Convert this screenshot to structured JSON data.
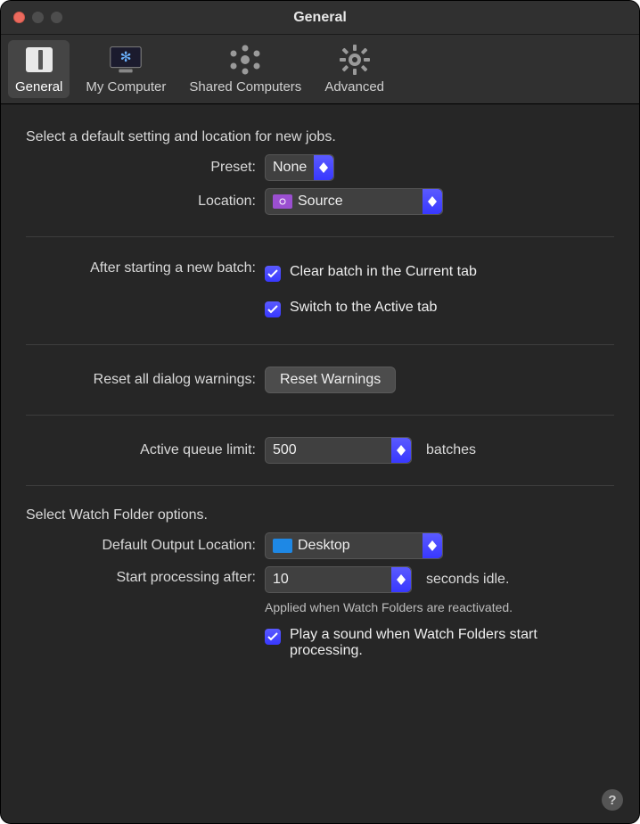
{
  "window": {
    "title": "General"
  },
  "tabs": {
    "general": "General",
    "my_computer": "My Computer",
    "shared": "Shared Computers",
    "advanced": "Advanced"
  },
  "section1": {
    "intro": "Select a default setting and location for new jobs.",
    "preset_label": "Preset:",
    "preset_value": "None",
    "location_label": "Location:",
    "location_value": "Source"
  },
  "section2": {
    "label": "After starting a new batch:",
    "clear": "Clear batch in the Current tab",
    "switch": "Switch to the Active tab"
  },
  "section3": {
    "label": "Reset all dialog warnings:",
    "button": "Reset Warnings"
  },
  "section4": {
    "label": "Active queue limit:",
    "value": "500",
    "suffix": "batches"
  },
  "section5": {
    "intro": "Select Watch Folder options.",
    "output_label": "Default Output Location:",
    "output_value": "Desktop",
    "start_label": "Start processing after:",
    "start_value": "10",
    "start_suffix": "seconds idle.",
    "note": "Applied when Watch Folders are reactivated.",
    "sound": "Play a sound when Watch Folders start processing."
  },
  "help": "?"
}
